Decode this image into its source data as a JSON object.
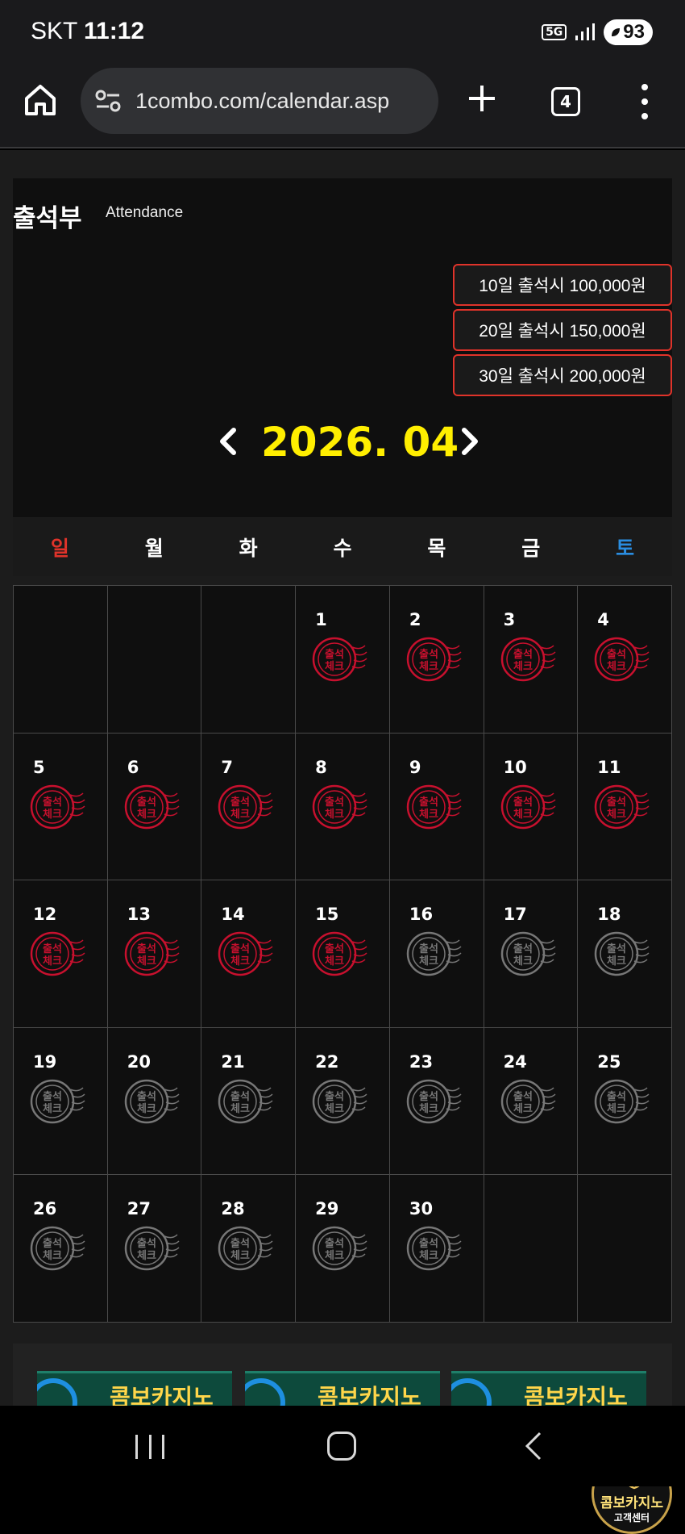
{
  "status_bar": {
    "carrier": "SKT",
    "time": "11:12",
    "network": "5G",
    "battery": "93"
  },
  "browser": {
    "url": "1combo.com/calendar.asp",
    "tab_count": "4"
  },
  "attendance": {
    "title": "출석부",
    "subtitle": "Attendance",
    "rewards": [
      "10일 출석시 100,000원",
      "20일 출석시 150,000원",
      "30일 출석시 200,000원"
    ],
    "month_label": "2026. 04"
  },
  "calendar": {
    "weekdays": [
      "일",
      "월",
      "화",
      "수",
      "목",
      "금",
      "토"
    ],
    "stamp_text": "출석 체크",
    "days": [
      {
        "day": "",
        "stamp": ""
      },
      {
        "day": "",
        "stamp": ""
      },
      {
        "day": "",
        "stamp": ""
      },
      {
        "day": "1",
        "stamp": "checked"
      },
      {
        "day": "2",
        "stamp": "checked"
      },
      {
        "day": "3",
        "stamp": "checked"
      },
      {
        "day": "4",
        "stamp": "checked"
      },
      {
        "day": "5",
        "stamp": "checked"
      },
      {
        "day": "6",
        "stamp": "checked"
      },
      {
        "day": "7",
        "stamp": "checked"
      },
      {
        "day": "8",
        "stamp": "checked"
      },
      {
        "day": "9",
        "stamp": "checked"
      },
      {
        "day": "10",
        "stamp": "checked"
      },
      {
        "day": "11",
        "stamp": "checked"
      },
      {
        "day": "12",
        "stamp": "checked"
      },
      {
        "day": "13",
        "stamp": "checked"
      },
      {
        "day": "14",
        "stamp": "checked"
      },
      {
        "day": "15",
        "stamp": "checked"
      },
      {
        "day": "16",
        "stamp": "unchecked"
      },
      {
        "day": "17",
        "stamp": "unchecked"
      },
      {
        "day": "18",
        "stamp": "unchecked"
      },
      {
        "day": "19",
        "stamp": "unchecked"
      },
      {
        "day": "20",
        "stamp": "unchecked"
      },
      {
        "day": "21",
        "stamp": "unchecked"
      },
      {
        "day": "22",
        "stamp": "unchecked"
      },
      {
        "day": "23",
        "stamp": "unchecked"
      },
      {
        "day": "24",
        "stamp": "unchecked"
      },
      {
        "day": "25",
        "stamp": "unchecked"
      },
      {
        "day": "26",
        "stamp": "unchecked"
      },
      {
        "day": "27",
        "stamp": "unchecked"
      },
      {
        "day": "28",
        "stamp": "unchecked"
      },
      {
        "day": "29",
        "stamp": "unchecked"
      },
      {
        "day": "30",
        "stamp": "unchecked"
      },
      {
        "day": "",
        "stamp": ""
      },
      {
        "day": "",
        "stamp": ""
      }
    ]
  },
  "banners": [
    "콤보카지노",
    "콤보카지노",
    "콤보카지노"
  ],
  "cs_badge": {
    "name": "콤보카지노",
    "sub": "고객센터"
  },
  "colors": {
    "month": "#ffee00",
    "sunday": "#e0332a",
    "saturday": "#2a8de0",
    "stamp_checked": "#c8102e",
    "stamp_unchecked": "#777777",
    "reward_border": "#e0332a"
  }
}
